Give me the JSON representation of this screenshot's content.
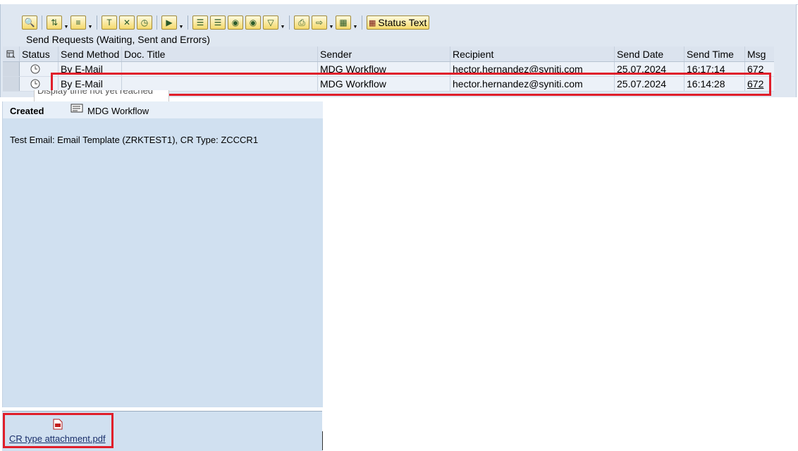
{
  "toolbar": {
    "buttons": [
      {
        "name": "detail-icon"
      },
      {
        "name": "sort-icon"
      },
      {
        "name": "filter-icon"
      },
      {
        "name": "text-icon"
      },
      {
        "name": "delete-icon"
      },
      {
        "name": "clock-icon"
      },
      {
        "name": "process-icon"
      },
      {
        "name": "align-icon"
      },
      {
        "name": "align2-icon"
      },
      {
        "name": "binoculars-icon"
      },
      {
        "name": "binoculars2-icon"
      },
      {
        "name": "funnel-icon"
      },
      {
        "name": "print-icon"
      },
      {
        "name": "export-icon"
      },
      {
        "name": "layout-icon"
      }
    ],
    "status_text_label": "Status Text"
  },
  "section_title": "Send Requests (Waiting, Sent and Errors)",
  "table": {
    "columns": [
      "Status",
      "Send Method",
      "Doc. Title",
      "Sender",
      "Recipient",
      "Send Date",
      "Send Time",
      "Msg"
    ],
    "rows": [
      {
        "method": "By E-Mail",
        "title": "",
        "sender": "MDG Workflow",
        "recipient": "hector.hernandez@syniti.com",
        "date": "25.07.2024",
        "time": "16:17:14",
        "msg": "672"
      },
      {
        "method": "By E-Mail",
        "title": "",
        "sender": "MDG Workflow",
        "recipient": "hector.hernandez@syniti.com",
        "date": "25.07.2024",
        "time": "16:14:28",
        "msg": "672"
      }
    ]
  },
  "tooltip_text": "Display time not yet reached",
  "detail": {
    "created_label": "Created",
    "created_by": "MDG Workflow",
    "subject": "Test Email: Email Template (ZRKTEST1), CR Type: ZCCCR1"
  },
  "attachment": {
    "name": "CR type attachment.pdf"
  },
  "colors": {
    "highlight": "#e01e2a",
    "panel": "#d0e0f0",
    "toolbar_button": "#f5d96a"
  }
}
